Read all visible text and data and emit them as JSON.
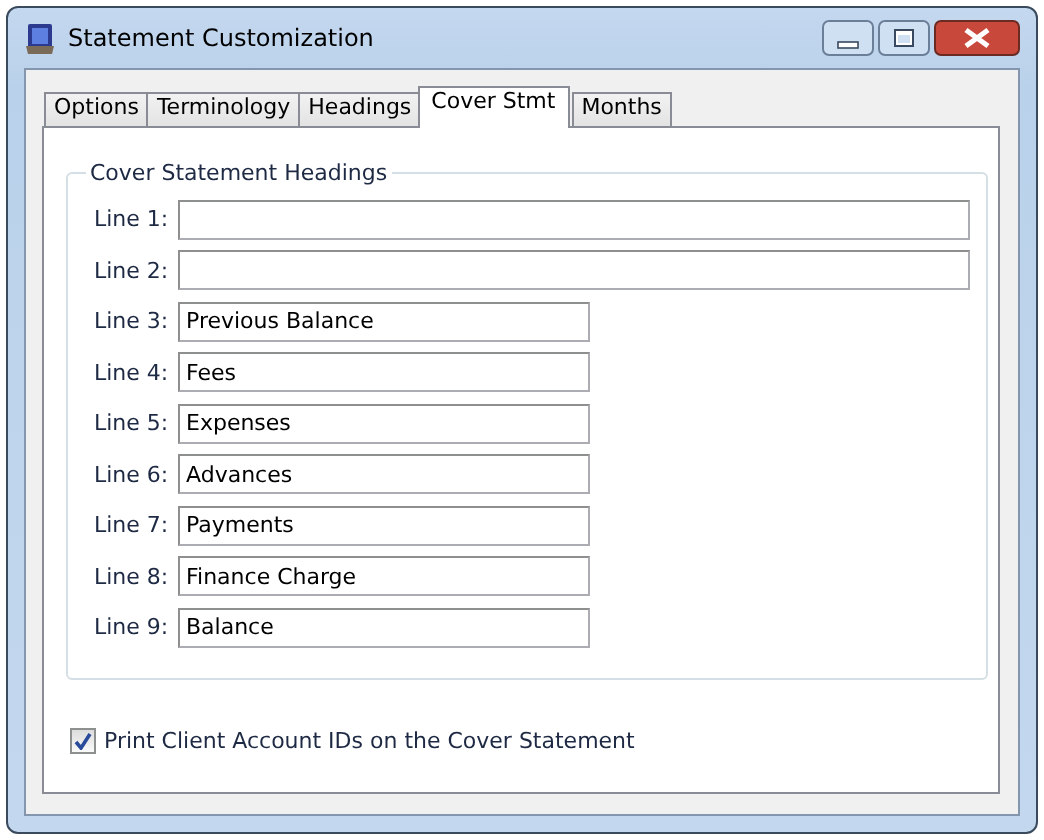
{
  "window": {
    "title": "Statement Customization"
  },
  "tabs": [
    {
      "label": "Options",
      "selected": false
    },
    {
      "label": "Terminology",
      "selected": false
    },
    {
      "label": "Headings",
      "selected": false
    },
    {
      "label": "Cover Stmt",
      "selected": true
    },
    {
      "label": "Months",
      "selected": false
    }
  ],
  "group": {
    "title": "Cover Statement Headings",
    "lines": [
      {
        "label": "Line 1:",
        "kind": "wide"
      },
      {
        "label": "Line 2:",
        "kind": "wide"
      },
      {
        "label": "Line 3:",
        "kind": "narrow",
        "value": "Previous Balance"
      },
      {
        "label": "Line 4:",
        "kind": "narrow",
        "value": "Fees"
      },
      {
        "label": "Line 5:",
        "kind": "narrow",
        "value": "Expenses"
      },
      {
        "label": "Line 6:",
        "kind": "narrow",
        "value": "Advances"
      },
      {
        "label": "Line 7:",
        "kind": "narrow",
        "value": "Payments"
      },
      {
        "label": "Line 8:",
        "kind": "narrow",
        "value": "Finance Charge"
      },
      {
        "label": "Line 9:",
        "kind": "narrow",
        "value": "Balance"
      }
    ]
  },
  "print_ids": {
    "label": "Print Client Account IDs on the Cover Statement",
    "checked": true
  }
}
